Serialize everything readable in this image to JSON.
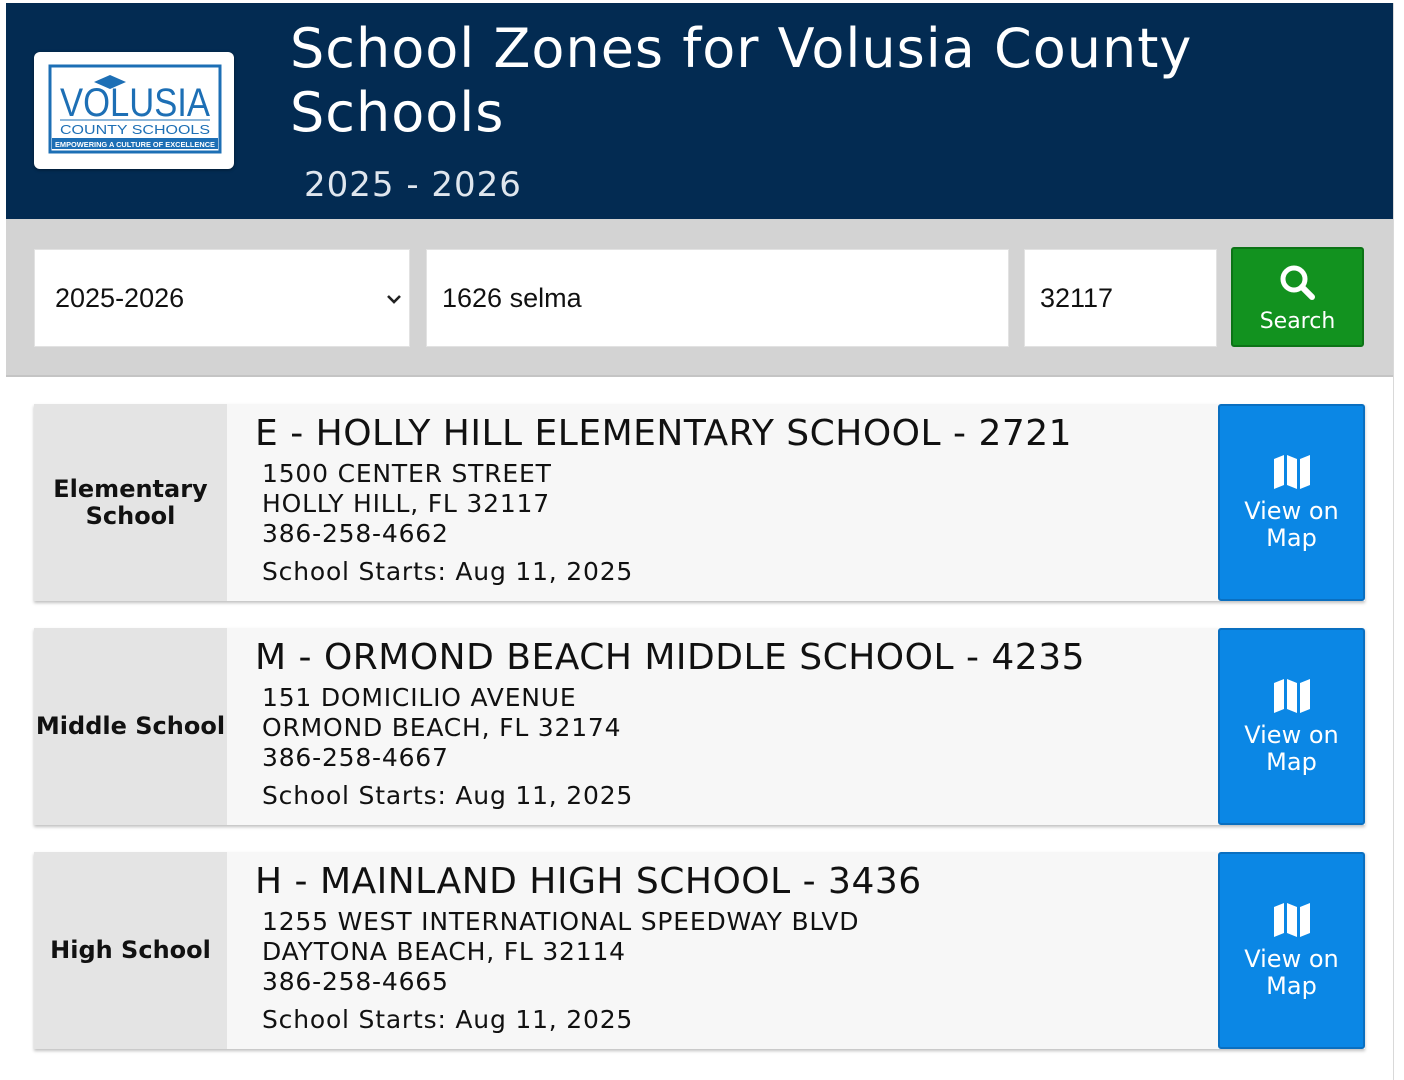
{
  "header": {
    "logo": {
      "brand": "VOLUSIA",
      "subtitle": "COUNTY SCHOOLS",
      "tagline": "EMPOWERING A CULTURE OF EXCELLENCE"
    },
    "title": "School Zones for Volusia County Schools",
    "year_label": "2025 - 2026"
  },
  "search": {
    "year_select": {
      "value": "2025-2026"
    },
    "address": {
      "value": "1626 selma"
    },
    "zip": {
      "value": "32117"
    },
    "button_label": "Search",
    "button_icon": "search-icon"
  },
  "results": [
    {
      "level": "Elementary School",
      "name": "E - HOLLY HILL ELEMENTARY SCHOOL - 2721",
      "street": "1500 CENTER STREET",
      "city": "HOLLY HILL, FL 32117",
      "phone": "386-258-4662",
      "starts": "School Starts: Aug 11, 2025",
      "map_button": "View on Map"
    },
    {
      "level": "Middle School",
      "name": "M - ORMOND BEACH MIDDLE SCHOOL - 4235",
      "street": "151 DOMICILIO AVENUE",
      "city": "ORMOND BEACH, FL 32174",
      "phone": "386-258-4667",
      "starts": "School Starts: Aug 11, 2025",
      "map_button": "View on Map"
    },
    {
      "level": "High School",
      "name": "H - MAINLAND HIGH SCHOOL - 3436",
      "street": "1255 WEST INTERNATIONAL SPEEDWAY BLVD",
      "city": "DAYTONA BEACH, FL 32114",
      "phone": "386-258-4665",
      "starts": "School Starts: Aug 11, 2025",
      "map_button": "View on Map"
    }
  ],
  "colors": {
    "header_bg": "#032b52",
    "search_bg": "#d3d3d3",
    "search_button": "#12921f",
    "map_button": "#0b87e5",
    "logo_blue": "#1d6fb5"
  }
}
